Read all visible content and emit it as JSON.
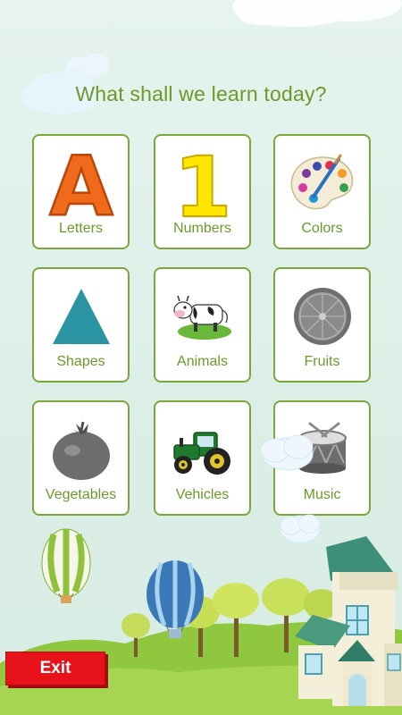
{
  "header": {
    "title": "What shall we learn today?"
  },
  "categories": [
    {
      "label": "Letters"
    },
    {
      "label": "Numbers"
    },
    {
      "label": "Colors"
    },
    {
      "label": "Shapes"
    },
    {
      "label": "Animals"
    },
    {
      "label": "Fruits"
    },
    {
      "label": "Vegetables"
    },
    {
      "label": "Vehicles"
    },
    {
      "label": "Music"
    }
  ],
  "glyphs": {
    "letter": "A",
    "number": "1"
  },
  "footer": {
    "exit_label": "Exit"
  },
  "colors": {
    "accent": "#6b9a2a",
    "tile_border": "#7aa83a",
    "exit": "#e8131a"
  }
}
